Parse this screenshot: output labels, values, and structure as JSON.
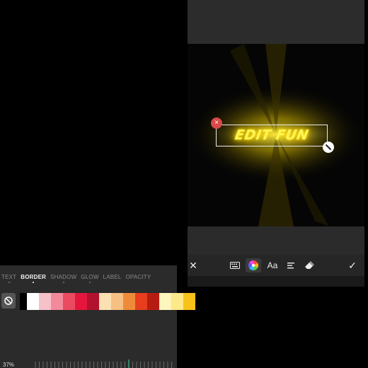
{
  "editor": {
    "tabs": [
      {
        "label": "TEXT",
        "active": false
      },
      {
        "label": "BORDER",
        "active": true
      },
      {
        "label": "SHADOW",
        "active": false
      },
      {
        "label": "GLOW",
        "active": false
      },
      {
        "label": "LABEL",
        "active": false
      },
      {
        "label": "OPACITY",
        "active": false
      }
    ],
    "no_color_icon": "no-color-icon",
    "swatches": [
      "#000000",
      "#ffffff",
      "#f6c1c9",
      "#f28a9b",
      "#ea4b60",
      "#e5163d",
      "#b2122e",
      "#fbe0b2",
      "#f6c083",
      "#ee8b3a",
      "#e63e1e",
      "#b61d10",
      "#fdf5be",
      "#fde88a",
      "#f8c21a"
    ],
    "slider_value": "37%",
    "slider_level": 0.37
  },
  "canvas": {
    "text": "EDIT FUN",
    "text_color": "#fff45a",
    "glow_color": "#ffd000",
    "delete_icon": "×"
  },
  "toolbar": {
    "close_icon": "✕",
    "keyboard_icon": "keyboard-icon",
    "color_wheel_icon": "color-wheel-icon",
    "font_label": "Aa",
    "align_icon": "align-left-icon",
    "eraser_icon": "eraser-icon",
    "confirm_icon": "✓"
  },
  "colors": {
    "panel": "#2b2b2b",
    "background": "#000000",
    "selection_delete": "#d84a4a"
  }
}
